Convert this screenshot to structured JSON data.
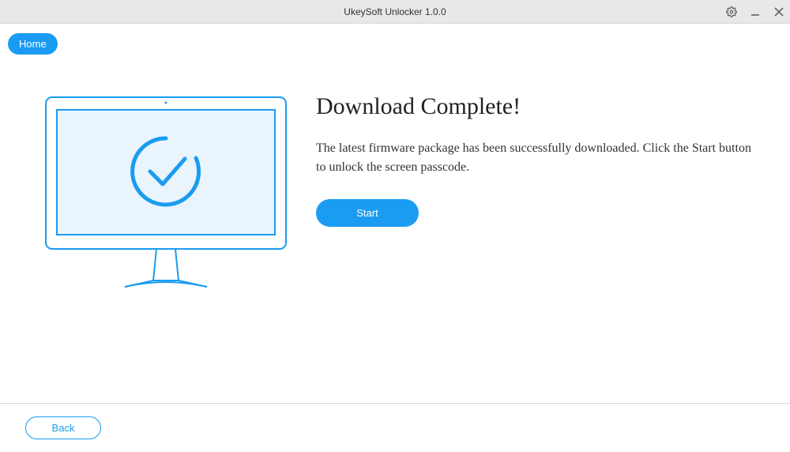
{
  "titlebar": {
    "title": "UkeySoft Unlocker 1.0.0"
  },
  "tabs": {
    "home": "Home"
  },
  "main": {
    "heading": "Download Complete!",
    "description": "The latest firmware package has been successfully downloaded. Click the Start button to unlock the screen passcode.",
    "start_label": "Start"
  },
  "footer": {
    "back_label": "Back"
  }
}
